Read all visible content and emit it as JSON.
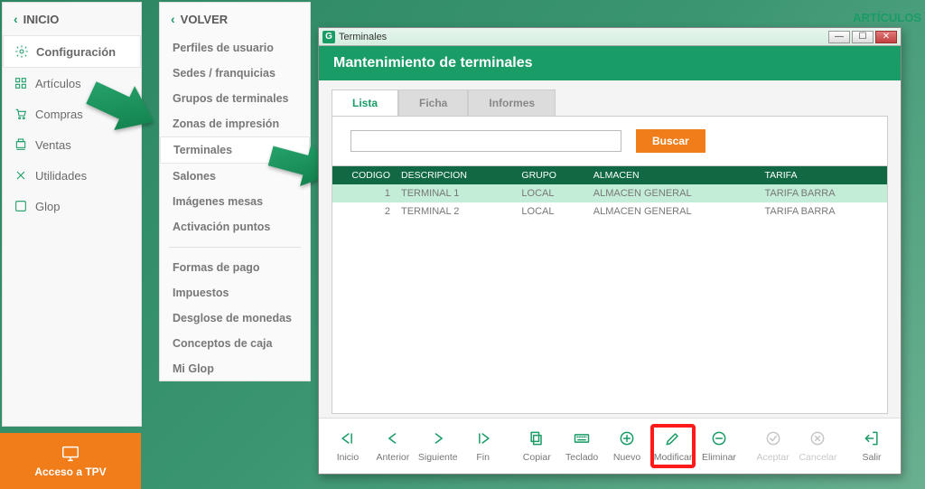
{
  "top_right": "ARTÍCULOS",
  "sidebar": {
    "header": "INICIO",
    "items": [
      {
        "label": "Configuración",
        "active": true,
        "icon": "gear"
      },
      {
        "label": "Artículos",
        "active": false,
        "icon": "grid"
      },
      {
        "label": "Compras",
        "active": false,
        "icon": "cart"
      },
      {
        "label": "Ventas",
        "active": false,
        "icon": "register"
      },
      {
        "label": "Utilidades",
        "active": false,
        "icon": "tools"
      },
      {
        "label": "Glop",
        "active": false,
        "icon": "g"
      }
    ]
  },
  "subpanel": {
    "header": "VOLVER",
    "group1": [
      "Perfiles de usuario",
      "Sedes / franquicias",
      "Grupos de terminales",
      "Zonas de impresión",
      "Terminales",
      "Salones",
      "Imágenes mesas",
      "Activación puntos"
    ],
    "selected": "Terminales",
    "group2": [
      "Formas de pago",
      "Impuestos",
      "Desglose de monedas",
      "Conceptos de caja",
      "Mi Glop"
    ]
  },
  "dialog": {
    "window_title": "Terminales",
    "header": "Mantenimiento de terminales",
    "tabs": [
      "Lista",
      "Ficha",
      "Informes"
    ],
    "active_tab": "Lista",
    "search": {
      "placeholder": "",
      "button": "Buscar"
    },
    "table": {
      "columns": [
        "CODIGO",
        "DESCRIPCION",
        "GRUPO",
        "ALMACEN",
        "TARIFA"
      ],
      "rows": [
        {
          "codigo": "1",
          "desc": "TERMINAL 1",
          "grupo": "LOCAL",
          "almacen": "ALMACEN GENERAL",
          "tarifa": "TARIFA BARRA",
          "selected": true
        },
        {
          "codigo": "2",
          "desc": "TERMINAL 2",
          "grupo": "LOCAL",
          "almacen": "ALMACEN GENERAL",
          "tarifa": "TARIFA BARRA",
          "selected": false
        }
      ]
    },
    "toolbar": [
      {
        "key": "inicio",
        "label": "Inicio",
        "enabled": true
      },
      {
        "key": "anterior",
        "label": "Anterior",
        "enabled": true
      },
      {
        "key": "siguiente",
        "label": "Siguiente",
        "enabled": true
      },
      {
        "key": "fin",
        "label": "Fin",
        "enabled": true
      },
      {
        "key": "copiar",
        "label": "Copiar",
        "enabled": true
      },
      {
        "key": "teclado",
        "label": "Teclado",
        "enabled": true
      },
      {
        "key": "nuevo",
        "label": "Nuevo",
        "enabled": true
      },
      {
        "key": "modificar",
        "label": "Modificar",
        "enabled": true,
        "highlight": true
      },
      {
        "key": "eliminar",
        "label": "Eliminar",
        "enabled": true
      },
      {
        "key": "aceptar",
        "label": "Aceptar",
        "enabled": false
      },
      {
        "key": "cancelar",
        "label": "Cancelar",
        "enabled": false
      },
      {
        "key": "salir",
        "label": "Salir",
        "enabled": true
      }
    ]
  },
  "tpv_button": "Acceso a TPV"
}
